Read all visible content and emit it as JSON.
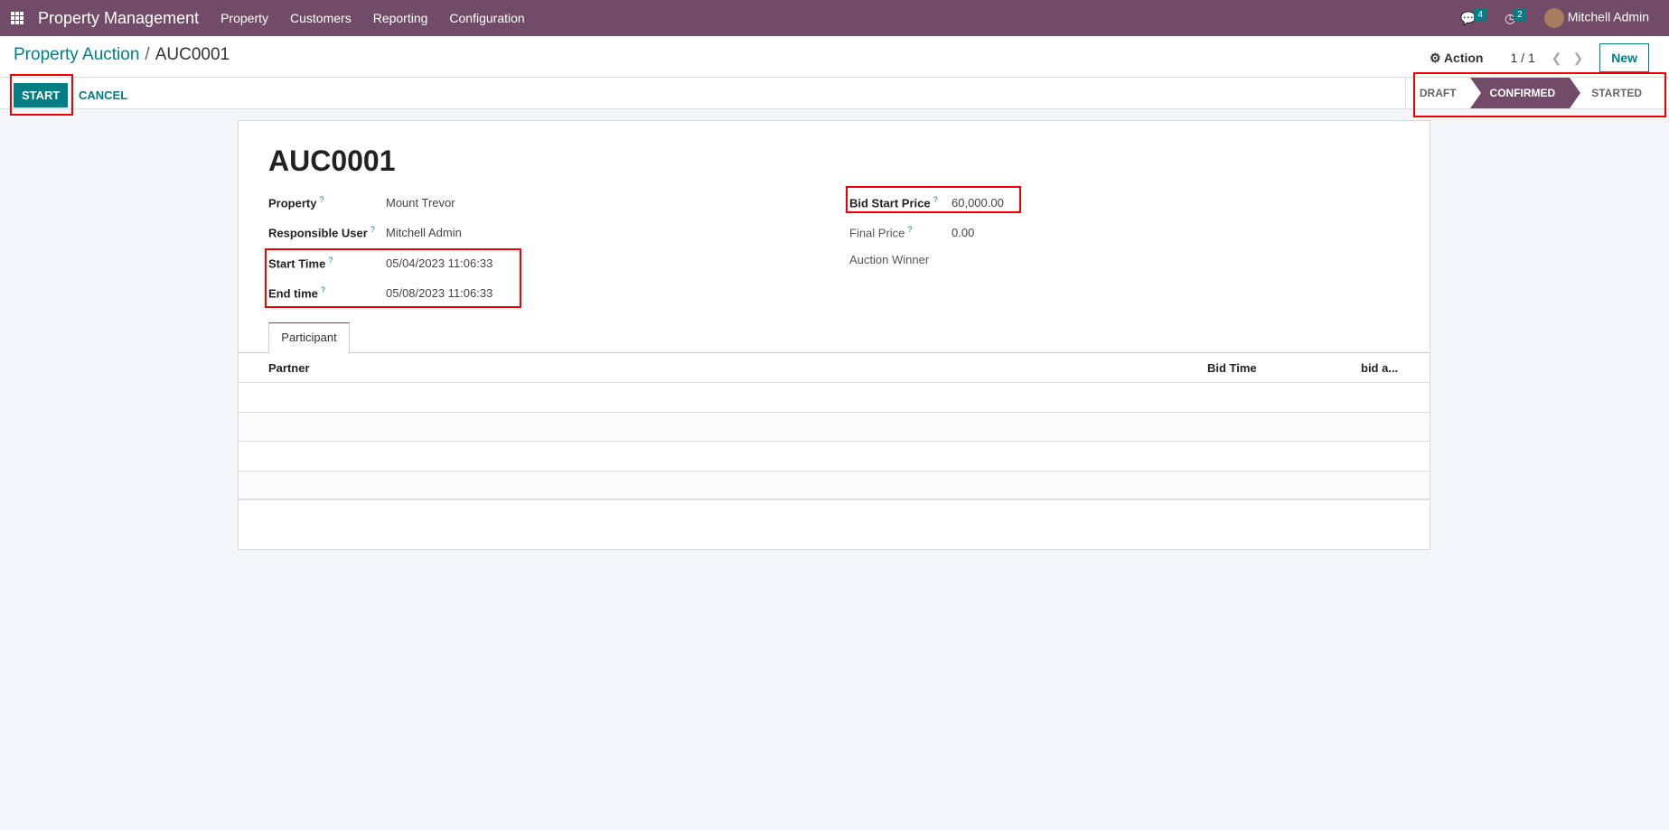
{
  "navbar": {
    "app_title": "Property Management",
    "menu": [
      "Property",
      "Customers",
      "Reporting",
      "Configuration"
    ],
    "messages_count": "4",
    "activities_count": "2",
    "user": "Mitchell Admin"
  },
  "header": {
    "breadcrumb_parent": "Property Auction",
    "breadcrumb_current": "AUC0001",
    "action_label": "Action",
    "pager": "1 / 1",
    "new_label": "New"
  },
  "controls": {
    "start_label": "START",
    "cancel_label": "CANCEL",
    "statuses": [
      "DRAFT",
      "CONFIRMED",
      "STARTED"
    ],
    "active_status": "CONFIRMED"
  },
  "form": {
    "title": "AUC0001",
    "left": [
      {
        "label": "Property",
        "value": "Mount Trevor"
      },
      {
        "label": "Responsible User",
        "value": "Mitchell Admin"
      },
      {
        "label": "Start Time",
        "value": "05/04/2023 11:06:33"
      },
      {
        "label": "End time",
        "value": "05/08/2023 11:06:33"
      }
    ],
    "right": [
      {
        "label": "Bid Start Price",
        "value": "60,000.00"
      },
      {
        "label": "Final Price",
        "value": "0.00"
      },
      {
        "label": "Auction Winner",
        "value": ""
      }
    ],
    "help_mark": "?",
    "tab": "Participant",
    "columns": [
      "Partner",
      "Bid Time",
      "bid a..."
    ]
  }
}
